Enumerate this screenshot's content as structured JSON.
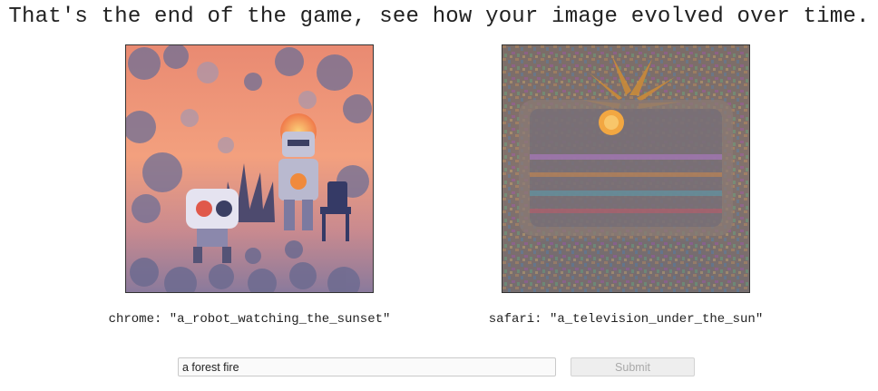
{
  "page": {
    "headline": "That's the end of the game, see how your image evolved over time."
  },
  "results": [
    {
      "caption": "chrome: \"a_robot_watching_the_sunset\"",
      "image_subject": "robot watching the sunset"
    },
    {
      "caption": "safari: \"a_television_under_the_sun\"",
      "image_subject": "television under the sun"
    }
  ],
  "form": {
    "input_value": "a forest fire",
    "submit_label": "Submit"
  },
  "colors": {
    "text": "#222222",
    "frame_border": "#333333",
    "input_border": "#c9c9c9",
    "button_bg": "#eeeeee",
    "button_text": "#a9a9a9"
  }
}
